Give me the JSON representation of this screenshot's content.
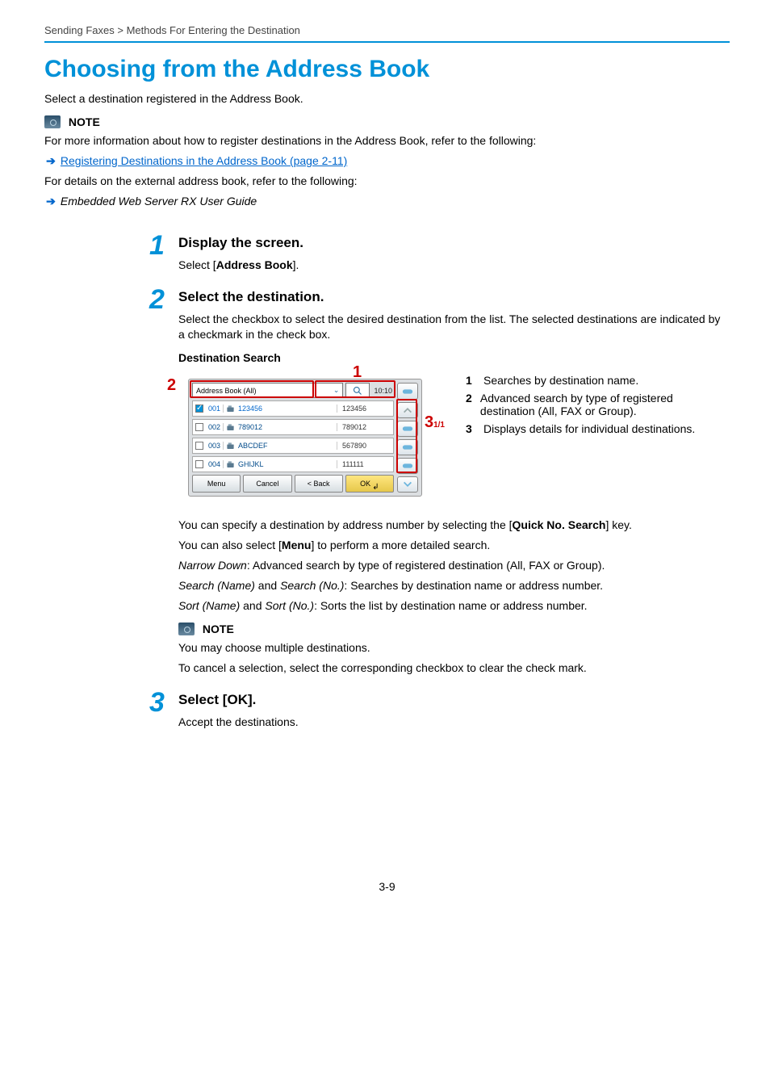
{
  "breadcrumb": {
    "a": "Sending Faxes",
    "sep": ">",
    "b": "Methods For Entering the Destination"
  },
  "title": "Choosing from the Address Book",
  "intro": "Select a destination registered in the Address Book.",
  "note1": {
    "label": "NOTE",
    "text": "For more information about how to register destinations in the Address Book, refer to the following:",
    "link": "Registering Destinations in the Address Book (page 2-11)",
    "text2": "For details on the external address book, refer to the following:",
    "ref": "Embedded Web Server RX User Guide"
  },
  "steps": {
    "s1": {
      "num": "1",
      "heading": "Display the screen.",
      "text_a": "Select [",
      "text_bold": "Address Book",
      "text_b": "]."
    },
    "s2": {
      "num": "2",
      "heading": "Select the destination.",
      "text": "Select the checkbox to select the desired destination from the list. The selected destinations are indicated by a checkmark in the check box.",
      "sub_heading": "Destination Search"
    },
    "s3": {
      "num": "3",
      "heading": "Select [OK].",
      "text": "Accept the destinations."
    }
  },
  "device": {
    "dropdown": "Address Book (All)",
    "time": "10:10",
    "rows": [
      {
        "checked": true,
        "num": "001",
        "name": "123456",
        "val": "123456"
      },
      {
        "checked": false,
        "num": "002",
        "name": "789012",
        "val": "789012"
      },
      {
        "checked": false,
        "num": "003",
        "name": "ABCDEF",
        "val": "567890"
      },
      {
        "checked": false,
        "num": "004",
        "name": "GHIJKL",
        "val": "111111"
      }
    ],
    "buttons": {
      "menu": "Menu",
      "cancel": "Cancel",
      "back": "< Back",
      "ok": "OK"
    },
    "side_page": "1/1"
  },
  "callouts": {
    "c1": "1",
    "c2": "2",
    "c3": "3"
  },
  "legend": {
    "i1": {
      "n": "1",
      "t": "Searches by destination name."
    },
    "i2": {
      "n": "2",
      "t": "Advanced search by type of registered destination (All, FAX or Group)."
    },
    "i3": {
      "n": "3",
      "t": "Displays details for individual destinations."
    }
  },
  "after": {
    "p1a": "You can specify a destination by address number by selecting the [",
    "p1b": "Quick No. Search",
    "p1c": "] key.",
    "p2a": "You can also select [",
    "p2b": "Menu",
    "p2c": "] to perform a more detailed search.",
    "p3a": "Narrow Down",
    "p3b": ": Advanced search by type of registered destination (All, FAX or Group).",
    "p4a": "Search (Name)",
    "p4mid": " and ",
    "p4b": "Search (No.)",
    "p4c": ": Searches by destination name or address number.",
    "p5a": "Sort (Name)",
    "p5b": "Sort (No.)",
    "p5c": ": Sorts the list by destination name or address number."
  },
  "note2": {
    "label": "NOTE",
    "l1": "You may choose multiple destinations.",
    "l2": "To cancel a selection, select the corresponding checkbox to clear the check mark."
  },
  "page_num": "3-9"
}
